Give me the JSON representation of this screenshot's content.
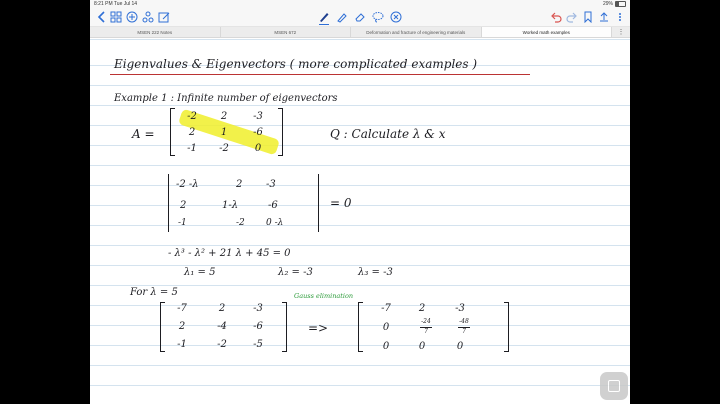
{
  "status_bar": {
    "time": "8:21 PM  Tue Jul 14",
    "battery": "29%"
  },
  "toolbar": {
    "left_icons": [
      "back-chevron-icon",
      "grid-view-icon",
      "add-page-icon",
      "share-icon",
      "edit-icon"
    ],
    "tools": [
      "pen-icon",
      "highlighter-icon",
      "eraser-icon",
      "lasso-icon",
      "close-circle-icon"
    ],
    "right_icons": [
      "undo-icon",
      "redo-icon",
      "bookmark-icon",
      "upload-icon",
      "more-icon"
    ]
  },
  "tabs": [
    {
      "label": "MSEN 222 Notes"
    },
    {
      "label": "MSEN 672"
    },
    {
      "label": "Deformation and fracture of engineering materials"
    },
    {
      "label": "Worked math examples"
    }
  ],
  "tabs_more": "⋮",
  "note": {
    "title": "Eigenvalues  &  Eigenvectors   ( more complicated examples )",
    "example": "Example 1 :  Infinite number of eigenvectors",
    "matrix_label": "A =",
    "matrix_A": [
      [
        "-2",
        "2",
        "-3"
      ],
      [
        "2",
        "1",
        "-6"
      ],
      [
        "-1",
        "-2",
        "0"
      ]
    ],
    "question": "Q :   Calculate   λ  &  x",
    "det_rows": [
      [
        "-2 -λ",
        "2",
        "-3"
      ],
      [
        "2",
        "1-λ",
        "-6"
      ],
      [
        "-1",
        "-2",
        "0 -λ"
      ]
    ],
    "det_eq": "= 0",
    "char_poly": "- λ³  -  λ²  +  21 λ  +  45  = 0",
    "eigen_1": "λ₁ = 5",
    "eigen_2": "λ₂ = -3",
    "eigen_3": "λ₃ = -3",
    "for_label": "For   λ = 5",
    "gauss_label": "Gauss elimination",
    "matrix_B": [
      [
        "-7",
        "2",
        "-3"
      ],
      [
        "2",
        "-4",
        "-6"
      ],
      [
        "-1",
        "-2",
        "-5"
      ]
    ],
    "arrow": "=>",
    "matrix_C_row1": [
      "-7",
      "2",
      "-3"
    ],
    "matrix_C_row2_first": "0",
    "matrix_C_frac1": {
      "num": "-24",
      "den": "7"
    },
    "matrix_C_frac2": {
      "num": "-48",
      "den": "7"
    },
    "matrix_C_row3": [
      "0",
      "0",
      "0"
    ]
  }
}
